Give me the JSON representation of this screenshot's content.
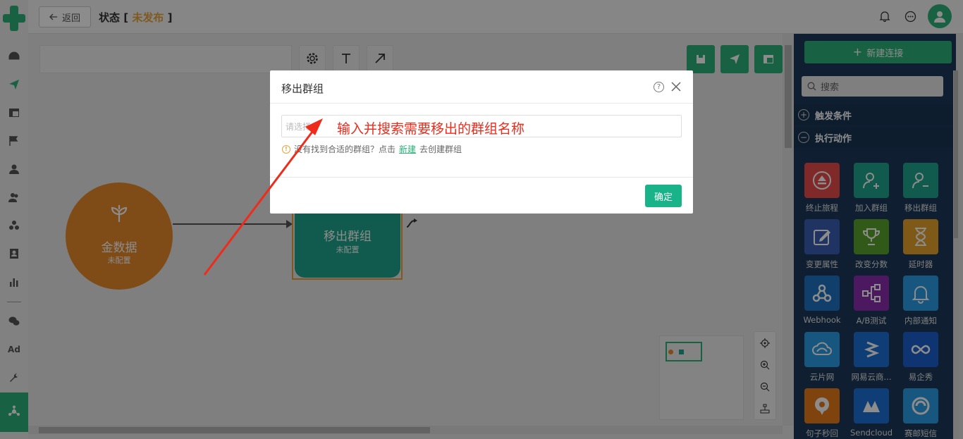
{
  "topbar": {
    "back_label": "返回",
    "title": "状态",
    "status": "未发布",
    "bracket_open": "[",
    "bracket_close": "]"
  },
  "canvas": {
    "start_node": {
      "title": "金数据",
      "subtitle": "未配置",
      "color": "#e8892a"
    },
    "action_node": {
      "title": "移出群组",
      "subtitle": "未配置",
      "color": "#1ea68c"
    }
  },
  "rightpanel": {
    "new_connection": "新建连接",
    "search_placeholder": "搜索",
    "sections": {
      "trigger": "触发条件",
      "action": "执行动作"
    },
    "tiles": [
      {
        "label": "终止旅程",
        "icon": "eject-icon",
        "color": "#e84c4c"
      },
      {
        "label": "加入群组",
        "icon": "user-add-icon",
        "color": "#1ea68c"
      },
      {
        "label": "移出群组",
        "icon": "user-remove-icon",
        "color": "#1ea68c"
      },
      {
        "label": "变更属性",
        "icon": "edit-icon",
        "color": "#3b5fb5"
      },
      {
        "label": "改变分数",
        "icon": "trophy-icon",
        "color": "#5aa52e"
      },
      {
        "label": "延时器",
        "icon": "hourglass-icon",
        "color": "#e8a32a"
      },
      {
        "label": "Webhook",
        "icon": "webhook-icon",
        "color": "#1c73c2"
      },
      {
        "label": "A/B测试",
        "icon": "ab-test-icon",
        "color": "#8b2cb0"
      },
      {
        "label": "内部通知",
        "icon": "bell-icon",
        "color": "#2a9de8"
      },
      {
        "label": "云片网",
        "icon": "cloud-icon",
        "color": "#2a9de8"
      },
      {
        "label": "网易云商...",
        "icon": "netease-icon",
        "color": "#1c6fd8"
      },
      {
        "label": "易企秀",
        "icon": "infinity-icon",
        "color": "#1d5fd0"
      },
      {
        "label": "句子秒回",
        "icon": "chat-bubble-icon",
        "color": "#e87b1a"
      },
      {
        "label": "Sendcloud",
        "icon": "sendcloud-icon",
        "color": "#1c6fd8"
      },
      {
        "label": "赛邮短信",
        "icon": "swirl-icon",
        "color": "#2a9de8"
      }
    ]
  },
  "modal": {
    "title": "移出群组",
    "help": "?",
    "select_placeholder": "请选择",
    "annotation": "输入并搜索需要移出的群组名称",
    "hint_warn": "!",
    "hint_before": "没有找到合适的群组？点击",
    "hint_link": "新建",
    "hint_after": "去创建群组",
    "ok": "确定"
  },
  "nav": {
    "ad_label": "Ad"
  },
  "colors": {
    "brand": "#2db37a",
    "annotation": "#ee2c1c",
    "status": "#e8a33b"
  }
}
